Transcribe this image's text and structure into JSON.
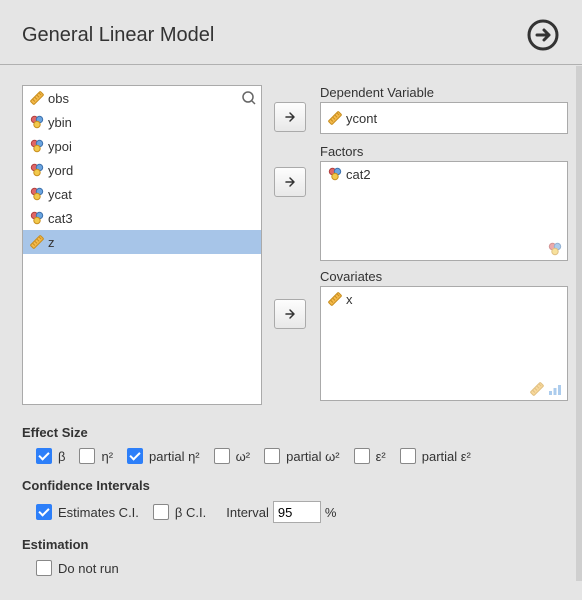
{
  "header": {
    "title": "General Linear Model"
  },
  "variables": [
    {
      "name": "obs",
      "kind": "continuous",
      "selected": false
    },
    {
      "name": "ybin",
      "kind": "nominal",
      "selected": false
    },
    {
      "name": "ypoi",
      "kind": "nominal",
      "selected": false
    },
    {
      "name": "yord",
      "kind": "nominal",
      "selected": false
    },
    {
      "name": "ycat",
      "kind": "nominal",
      "selected": false
    },
    {
      "name": "cat3",
      "kind": "nominal",
      "selected": false
    },
    {
      "name": "z",
      "kind": "continuous",
      "selected": true
    }
  ],
  "dependent": {
    "label": "Dependent Variable",
    "item": {
      "name": "ycont",
      "kind": "continuous"
    }
  },
  "factors": {
    "label": "Factors",
    "items": [
      {
        "name": "cat2",
        "kind": "nominal"
      }
    ]
  },
  "covariates": {
    "label": "Covariates",
    "items": [
      {
        "name": "x",
        "kind": "continuous"
      }
    ]
  },
  "effect_size": {
    "heading": "Effect Size",
    "options": [
      {
        "key": "beta",
        "label": "β",
        "checked": true
      },
      {
        "key": "eta2",
        "label": "η²",
        "checked": false
      },
      {
        "key": "partial_eta2",
        "label": "partial η²",
        "checked": true
      },
      {
        "key": "omega2",
        "label": "ω²",
        "checked": false
      },
      {
        "key": "partial_omega2",
        "label": "partial ω²",
        "checked": false
      },
      {
        "key": "epsilon2",
        "label": "ε²",
        "checked": false
      },
      {
        "key": "partial_epsilon2",
        "label": "partial ε²",
        "checked": false
      }
    ]
  },
  "confidence": {
    "heading": "Confidence Intervals",
    "estimates_ci": {
      "label": "Estimates C.I.",
      "checked": true
    },
    "beta_ci": {
      "label": "β C.I.",
      "checked": false
    },
    "interval_label": "Interval",
    "interval_value": "95",
    "interval_unit": "%"
  },
  "estimation": {
    "heading": "Estimation",
    "do_not_run": {
      "label": "Do not run",
      "checked": false
    }
  }
}
